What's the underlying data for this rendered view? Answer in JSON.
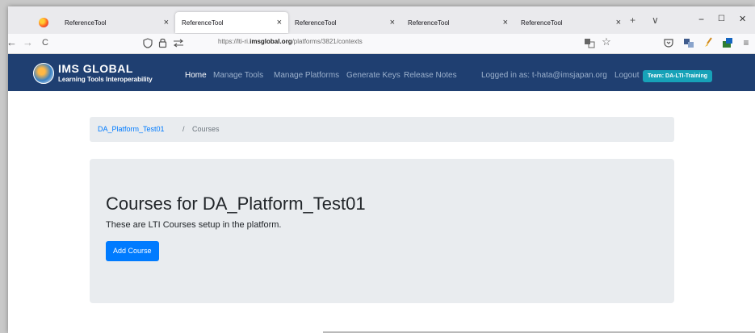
{
  "browser": {
    "tabs": [
      {
        "title": "ReferenceTool",
        "active": false
      },
      {
        "title": "ReferenceTool",
        "active": true
      },
      {
        "title": "ReferenceTool",
        "active": false
      },
      {
        "title": "ReferenceTool",
        "active": false
      },
      {
        "title": "ReferenceTool",
        "active": false
      }
    ],
    "close_glyph": "×",
    "new_tab_glyph": "+",
    "tab_list_glyph": "∨",
    "window_controls": {
      "minimize": "−",
      "maximize": "☐",
      "close": "✕"
    },
    "nav": {
      "back": "←",
      "forward": "→",
      "reload": "C"
    },
    "url": {
      "prefix": "https://lti-ri.",
      "domain": "imsglobal.org",
      "path": "/platforms/3821/contexts"
    },
    "toolbar_icons": [
      "translate-icon",
      "star-icon",
      "pocket-icon",
      "translate-icon",
      "brush-icon",
      "extension-icon",
      "menu-icon"
    ]
  },
  "site": {
    "brand_line1": "IMS GLOBAL",
    "brand_line2": "Learning Tools Interoperability",
    "nav": [
      {
        "label": "Home",
        "active": true
      },
      {
        "label": "Manage Tools",
        "active": false
      },
      {
        "label": "Manage Platforms",
        "active": false
      },
      {
        "label": "Generate Keys",
        "active": false
      },
      {
        "label": "Release Notes",
        "active": false
      }
    ],
    "logged_in_text": "Logged in as: t-hata@imsjapan.org",
    "logout": "Logout",
    "team_badge": "Team: DA-LTI-Training",
    "header_color": "#1f3f71"
  },
  "main": {
    "breadcrumb": {
      "platform": "DA_Platform_Test01",
      "separator": "/",
      "current": "Courses"
    },
    "title": "Courses for DA_Platform_Test01",
    "subtitle": "These are LTI Courses setup in the platform.",
    "add_button": "Add Course",
    "button_color": "#007bff"
  }
}
